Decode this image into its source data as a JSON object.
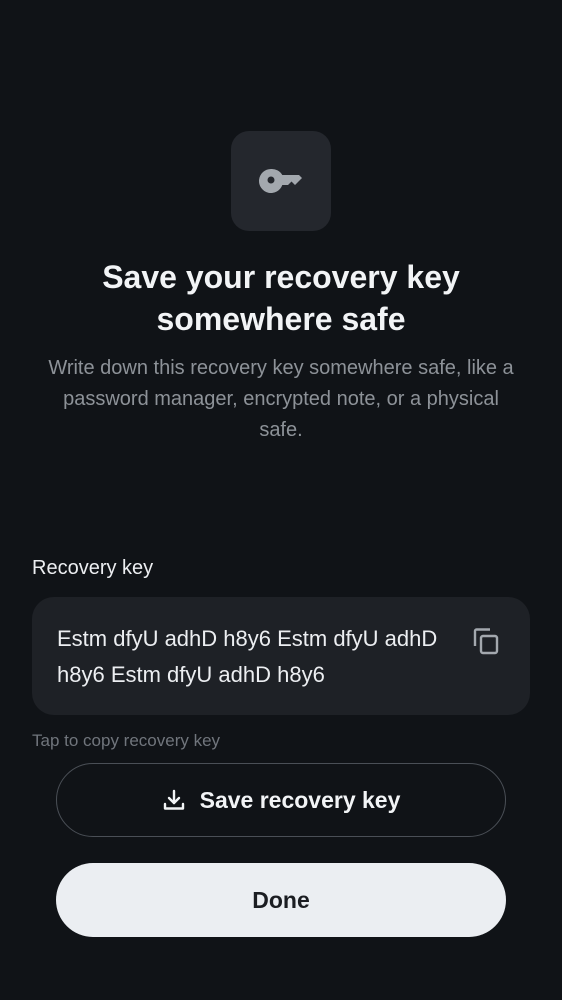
{
  "header": {
    "icon": "key-icon",
    "title": "Save your recovery key somewhere safe",
    "description": "Write down this recovery key somewhere safe, like a password manager, encrypted note, or a physical safe."
  },
  "recovery_key": {
    "label": "Recovery key",
    "value": "Estm dfyU adhD h8y6 Estm dfyU adhD h8y6 Estm dfyU adhD h8y6",
    "copy_icon": "copy-icon",
    "hint": "Tap to copy recovery key"
  },
  "actions": {
    "save_label": "Save recovery key",
    "save_icon": "download-icon",
    "done_label": "Done"
  },
  "colors": {
    "background": "#101317",
    "tile": "#24272D",
    "key_box": "#1E2126",
    "primary_button": "#EBEEF2",
    "muted_text": "#8D9298"
  }
}
